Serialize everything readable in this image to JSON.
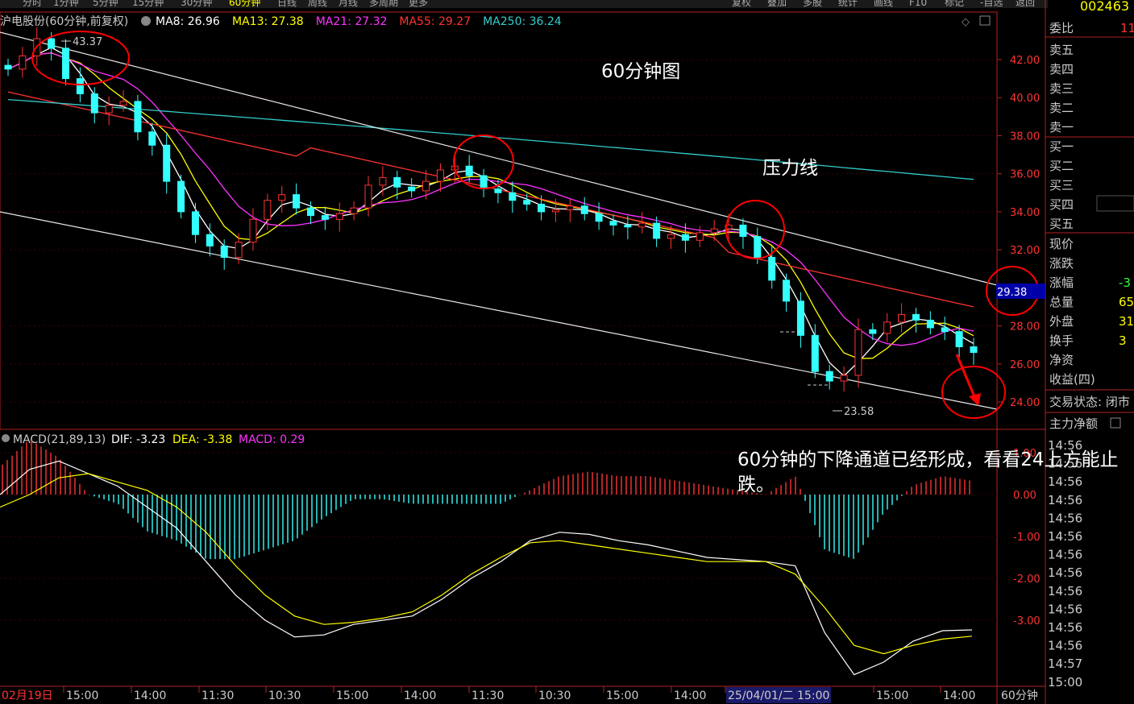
{
  "top_tabs": [
    "分时",
    "1分钟",
    "5分钟",
    "15分钟",
    "30分钟",
    "60分钟",
    "日线",
    "周线",
    "月线",
    "多周期",
    "更多"
  ],
  "top_tools": [
    "复权",
    "叠加",
    "多股",
    "统计",
    "画线",
    "F10",
    "标记",
    "-自选",
    "返回"
  ],
  "stock_code": "002463",
  "chart_title": "沪电股份(60分钟,前复权)",
  "ma_legend": [
    {
      "label": "MA8: 26.96",
      "color": "#ffffff"
    },
    {
      "label": "MA13: 27.38",
      "color": "#ffff00"
    },
    {
      "label": "MA21: 27.32",
      "color": "#ff33ff"
    },
    {
      "label": "MA55: 29.27",
      "color": "#ff3333"
    },
    {
      "label": "MA250: 36.24",
      "color": "#33cccc"
    }
  ],
  "colors": {
    "up": "#ff3333",
    "down": "#33ffff",
    "ma8": "#ffffff",
    "ma13": "#ffff00",
    "ma21": "#ff33ff",
    "ma55": "#ff3333",
    "ma250": "#33cccc",
    "annotation": "#ff0000",
    "panel_border": "#b22222"
  },
  "annotations": {
    "title_note": "60分钟图",
    "pressure_line": "压力线",
    "comment": "60分钟的下降通道已经形成，看看24上方能止跌。",
    "high_label": "43.37",
    "low_label": "23.58",
    "current_price": "29.38"
  },
  "price_axis": [
    "42.00",
    "40.00",
    "38.00",
    "36.00",
    "34.00",
    "32.00",
    "28.00",
    "26.00",
    "24.00"
  ],
  "macd_axis": [
    "1.00",
    "0.00",
    "-1.00",
    "-2.00",
    "-3.00"
  ],
  "macd_legend": {
    "name": "MACD(21,89,13)",
    "dif": "DIF: -3.23",
    "dea": "DEA: -3.38",
    "macd": "MACD: 0.29"
  },
  "time_axis": [
    "02月19日",
    "15:00",
    "14:00",
    "11:30",
    "10:30",
    "15:00",
    "14:00",
    "11:30",
    "10:30",
    "15:00",
    "14:00",
    "25/04/01/二 15:00",
    "15:00",
    "14:00"
  ],
  "period_label": "60分钟",
  "side_panel": {
    "weibi": "委比",
    "weibi_value": "11",
    "orders": [
      "卖五",
      "卖四",
      "卖三",
      "卖二",
      "卖一",
      "买一",
      "买二",
      "买三",
      "买四",
      "买五"
    ],
    "stats": [
      {
        "label": "现价",
        "value": ""
      },
      {
        "label": "涨跌",
        "value": ""
      },
      {
        "label": "涨幅",
        "value": "-3"
      },
      {
        "label": "总量",
        "value": "65"
      },
      {
        "label": "外盘",
        "value": "31"
      },
      {
        "label": "换手",
        "value": "3"
      },
      {
        "label": "净资",
        "value": ""
      },
      {
        "label": "收益(四)",
        "value": ""
      }
    ],
    "trade_status": "交易状态: 闭市",
    "net_inflow": "主力净额",
    "ticks": [
      "14:56",
      "14:56",
      "14:56",
      "14:56",
      "14:56",
      "14:56",
      "14:56",
      "14:56",
      "14:56",
      "14:56",
      "14:56",
      "14:56",
      "14:57",
      "15:00"
    ]
  },
  "chart_data": [
    {
      "type": "candlestick",
      "title": "沪电股份(60分钟,前复权)",
      "ylim": [
        23,
        44
      ],
      "yticks": [
        24,
        26,
        28,
        32,
        34,
        36,
        38,
        40,
        42
      ],
      "series_ma_latest": {
        "MA8": 26.96,
        "MA13": 27.38,
        "MA21": 27.32,
        "MA55": 29.27,
        "MA250": 36.24
      },
      "extremes": {
        "high": 43.37,
        "low": 23.58
      },
      "last_price": 29.38,
      "close_path": [
        41.5,
        42.2,
        43.1,
        42.6,
        41.0,
        40.2,
        39.2,
        39.6,
        39.8,
        38.2,
        37.5,
        35.6,
        34.0,
        32.8,
        32.2,
        31.6,
        32.4,
        33.6,
        34.6,
        34.9,
        34.2,
        33.8,
        33.6,
        33.9,
        34.2,
        35.4,
        35.8,
        35.3,
        35.1,
        35.6,
        36.2,
        36.4,
        35.9,
        35.2,
        35.0,
        34.6,
        34.4,
        34.0,
        34.1,
        34.3,
        33.9,
        33.5,
        33.3,
        33.2,
        33.4,
        32.6,
        32.8,
        32.5,
        32.9,
        33.1,
        33.3,
        32.7,
        31.6,
        30.4,
        29.3,
        27.5,
        25.6,
        25.1,
        25.4,
        27.8,
        27.6,
        28.2,
        28.6,
        28.3,
        27.9,
        27.7,
        26.9,
        26.6
      ]
    },
    {
      "type": "macd",
      "name": "MACD(21,89,13)",
      "ylim": [
        -4.2,
        1.5
      ],
      "latest": {
        "DIF": -3.23,
        "DEA": -3.38,
        "MACD": 0.29
      },
      "dif": [
        0.0,
        0.6,
        0.8,
        0.5,
        0.2,
        -0.3,
        -0.8,
        -1.6,
        -2.4,
        -3.0,
        -3.4,
        -3.35,
        -3.1,
        -3.0,
        -2.9,
        -2.5,
        -2.0,
        -1.6,
        -1.1,
        -0.9,
        -0.95,
        -1.1,
        -1.2,
        -1.35,
        -1.5,
        -1.55,
        -1.6,
        -1.7,
        -3.3,
        -4.3,
        -4.0,
        -3.5,
        -3.25,
        -3.23
      ],
      "dea": [
        -0.3,
        0.0,
        0.4,
        0.5,
        0.3,
        0.1,
        -0.3,
        -0.9,
        -1.7,
        -2.4,
        -2.9,
        -3.1,
        -3.05,
        -2.95,
        -2.8,
        -2.4,
        -1.9,
        -1.5,
        -1.15,
        -1.1,
        -1.2,
        -1.3,
        -1.4,
        -1.5,
        -1.6,
        -1.6,
        -1.6,
        -1.9,
        -2.7,
        -3.6,
        -3.8,
        -3.6,
        -3.45,
        -3.38
      ]
    }
  ]
}
